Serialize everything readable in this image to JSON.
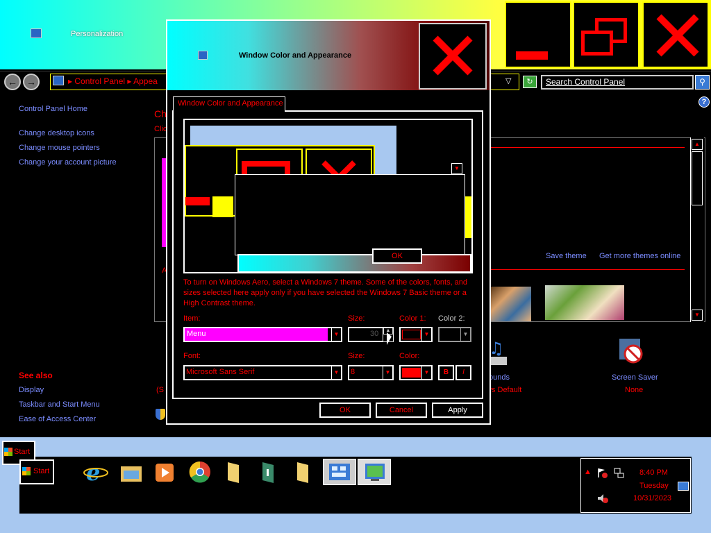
{
  "background_window": {
    "title": "Personalization",
    "address_crumb": "▸ Control Panel ▸ Appea",
    "search_placeholder": "Search Control Panel",
    "sidebar": {
      "home": "Control Panel Home",
      "links": [
        "Change desktop icons",
        "Change mouse pointers",
        "Change your account picture"
      ],
      "see_also_heading": "See also",
      "see_also": [
        "Display",
        "Taskbar and Start Menu",
        "Ease of Access Center"
      ]
    },
    "heading": "Ch",
    "subtext": "Clic",
    "theme_mark": "A",
    "save_theme": "Save theme",
    "more_themes": "Get more themes online",
    "fragment": "(S",
    "sounds_label": "ounds",
    "sounds_value": "ws Default",
    "saver_label": "Screen Saver",
    "saver_value": "None"
  },
  "dialog": {
    "title": "Window Color and Appearance",
    "tab": "Window Color and Appearance",
    "preview_ok": "OK",
    "note": "To turn on Windows Aero, select a Windows 7 theme.  Some of the colors, fonts, and sizes selected here apply only if you have selected the Windows 7 Basic theme or a High Contrast theme.",
    "labels": {
      "item": "Item:",
      "size": "Size:",
      "color1": "Color 1:",
      "color2": "Color 2:",
      "font": "Font:",
      "size2": "Size:",
      "color": "Color:"
    },
    "values": {
      "item": "Menu",
      "item_size": "30",
      "font": "Microsoft Sans Serif",
      "font_size": "8",
      "bold": "B",
      "italic": "I"
    },
    "buttons": {
      "ok": "OK",
      "cancel": "Cancel",
      "apply": "Apply"
    }
  },
  "taskbar": {
    "start": "Start",
    "start_float": "Start",
    "clock": {
      "time": "8:40 PM",
      "day": "Tuesday",
      "date": "10/31/2023"
    }
  },
  "colors": {
    "accent": "#ff0000",
    "link": "#7b8cff",
    "highlight": "#ff00ff",
    "border_yellow": "#ffff00"
  }
}
